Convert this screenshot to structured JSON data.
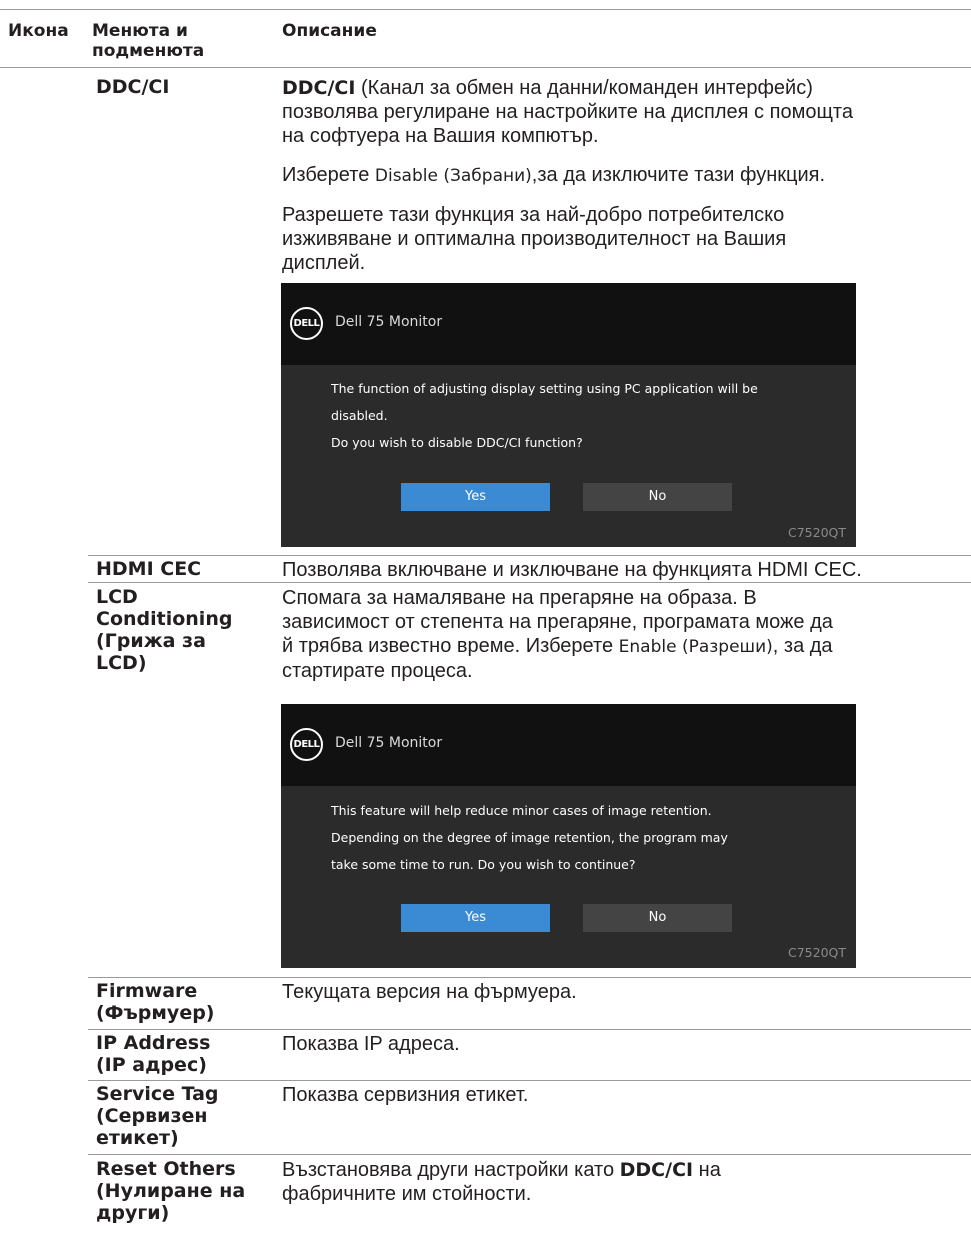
{
  "header": {
    "icon_col": "Икона",
    "menu_col_1": "Менюта и",
    "menu_col_2": "подменюта",
    "desc_col": "Описание"
  },
  "rows": {
    "ddcci": {
      "menu": "DDC/CI",
      "desc_bold": "DDC/CI",
      "desc_p1_l1": " (Канал за обмен на данни/команден интерфейс)",
      "desc_p1_l2": "позволява регулиране на настройките на дисплея с помощта",
      "desc_p1_l3": "на софтуера на Вашия компютър.",
      "desc_p2_a": "Изберете ",
      "desc_p2_small": "Disable (Забрани)",
      "desc_p2_b": ",за да изключите тази функция.",
      "desc_p3_l1": "Разрешете тази функция за най-добро потребителско",
      "desc_p3_l2": "изживяване и оптимална производителност на Вашия",
      "desc_p3_l3": "дисплей.",
      "dialog": {
        "logo": "DELL",
        "model": "Dell 75 Monitor",
        "line1": "The function of adjusting display setting using PC application will be",
        "line2": "disabled.",
        "line3": "Do you wish to disable DDC/CI function?",
        "yes": "Yes",
        "no": "No",
        "code": "C7520QT"
      }
    },
    "hdmi": {
      "menu": "HDMI CEC",
      "desc": "Позволява включване и изключване на функцията HDMI CEC."
    },
    "lcd": {
      "menu_l1": "LCD",
      "menu_l2": "Conditioning",
      "menu_l3": "(Грижа за",
      "menu_l4": "LCD)",
      "desc_l1": "Спомага за намаляване на прегаряне на образа. В",
      "desc_l2": "зависимост от степента на прегаряне, програмата може да",
      "desc_l3": "й трябва известно време. Изберете ",
      "desc_l3_small": "Enable (Разреши)",
      "desc_l3_b": ", за да",
      "desc_l4": "стартирате процеса.",
      "dialog": {
        "logo": "DELL",
        "model": "Dell 75 Monitor",
        "line1": "This feature will help reduce minor cases of image retention.",
        "line2": "Depending on the degree of image retention, the program may",
        "line3": "take some time to run. Do you wish to continue?",
        "yes": "Yes",
        "no": "No",
        "code": "C7520QT"
      }
    },
    "firmware": {
      "menu_l1": "Firmware",
      "menu_l2": "(Фърмуер)",
      "desc": "Текущата версия на фърмуера."
    },
    "ip": {
      "menu_l1": "IP Address",
      "menu_l2": "(IP адрес)",
      "desc": "Показва IP адреса."
    },
    "service": {
      "menu_l1": "Service Tag",
      "menu_l2": "(Сервизен",
      "menu_l3": "етикет)",
      "desc": "Показва сервизния етикет."
    },
    "reset": {
      "menu_l1": "Reset Others",
      "menu_l2": "(Нулиране на",
      "menu_l3": "други)",
      "desc_a": "Възстановява други настройки като ",
      "desc_bold": "DDC/CI",
      "desc_b": " на",
      "desc_l2": "фабричните им стойности."
    }
  }
}
